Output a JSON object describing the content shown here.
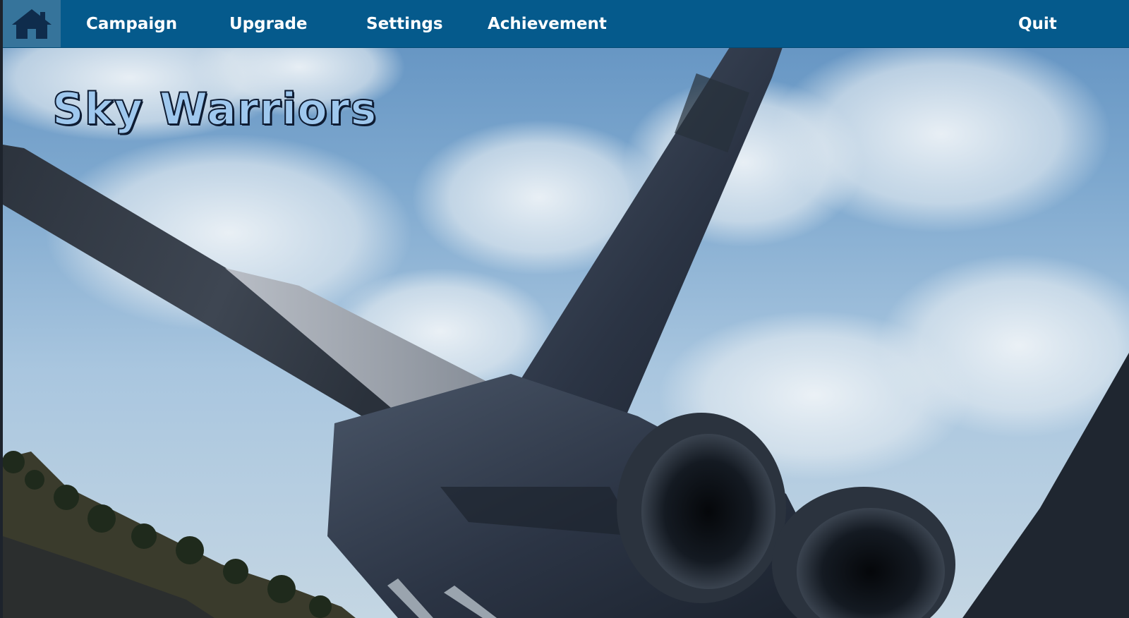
{
  "nav": {
    "home_icon": "home-icon",
    "items": [
      {
        "label": "Campaign"
      },
      {
        "label": "Upgrade"
      },
      {
        "label": "Settings"
      },
      {
        "label": "Achievement"
      }
    ],
    "quit_label": "Quit"
  },
  "title": "Sky Warriors",
  "colors": {
    "nav_bar": "#055a8c",
    "home_tile": "#36749b",
    "title_fill": "#9fc8ee",
    "title_outline": "#0e1c33"
  }
}
